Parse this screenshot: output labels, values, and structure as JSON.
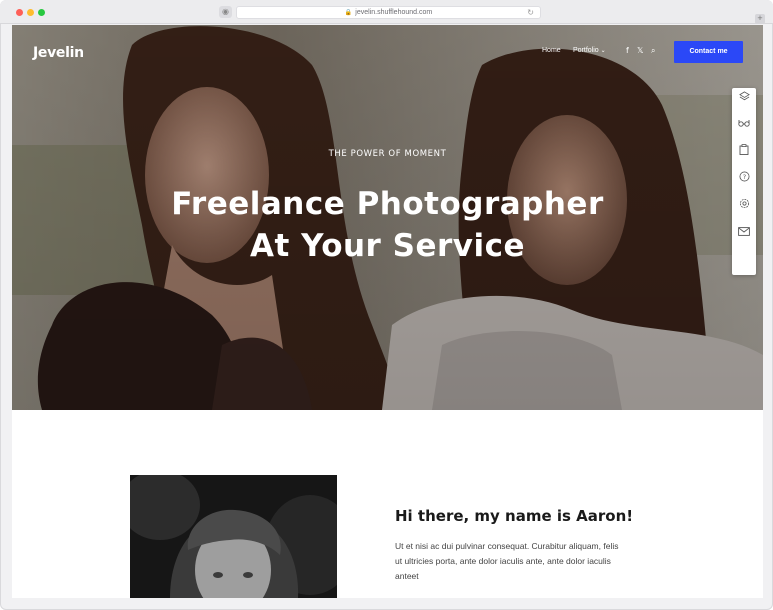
{
  "browser": {
    "url": "jevelin.shufflehound.com"
  },
  "nav": {
    "logo": "Jevelin",
    "links": [
      "Home",
      "Portfolio"
    ],
    "portfolio_caret": "⌄",
    "social": [
      "f",
      "𝕏"
    ],
    "contact_label": "Contact me"
  },
  "hero": {
    "eyebrow": "THE POWER OF MOMENT",
    "title_line1": "Freelance Photographer",
    "title_line2": "At Your Service"
  },
  "side_toolbar": {
    "icons": [
      "layers-icon",
      "glasses-icon",
      "clipboard-icon",
      "help-icon",
      "settings-icon",
      "mail-icon"
    ]
  },
  "about": {
    "title": "Hi there, my name is Aaron!",
    "text": "Ut et nisi ac dui pulvinar consequat. Curabitur aliquam, felis ut ultricies porta, ante dolor iaculis ante, ante dolor iaculis anteet"
  },
  "colors": {
    "accent": "#2b48f7",
    "hero_text": "#ffffff",
    "body_text": "#444444"
  }
}
